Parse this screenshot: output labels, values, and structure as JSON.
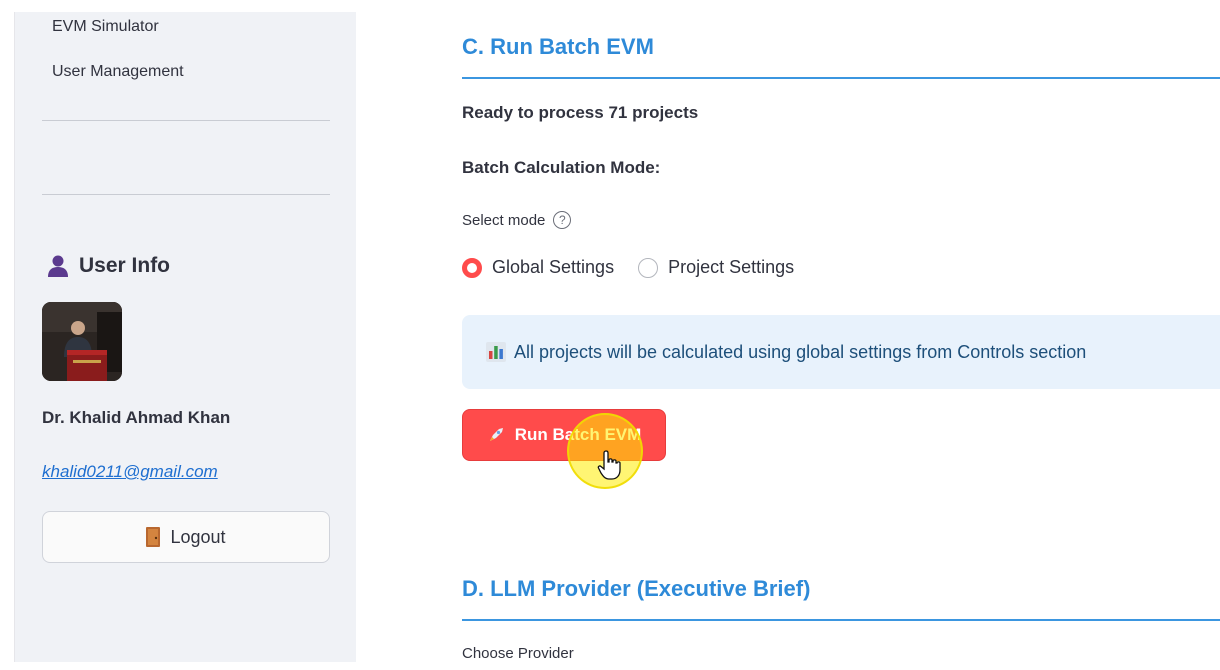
{
  "sidebar": {
    "nav_items": [
      {
        "label": "EVM Simulator"
      },
      {
        "label": "User Management"
      }
    ],
    "user_info": {
      "heading": "User Info",
      "name": "Dr. Khalid Ahmad Khan",
      "email": "khalid0211@gmail.com",
      "logout_label": "Logout"
    }
  },
  "main": {
    "section_c": {
      "title": "C. Run Batch EVM",
      "ready_text": "Ready to process 71 projects",
      "mode_heading": "Batch Calculation Mode:",
      "select_label": "Select mode",
      "help_glyph": "?",
      "options": [
        {
          "label": "Global Settings",
          "selected": true
        },
        {
          "label": "Project Settings",
          "selected": false
        }
      ],
      "info_text": "All projects will be calculated using global settings from Controls section",
      "run_button_label": "Run Batch EVM"
    },
    "section_d": {
      "title": "D. LLM Provider (Executive Brief)",
      "choose_label": "Choose Provider"
    }
  },
  "colors": {
    "accent_red": "#ff4b4b",
    "heading_blue": "#2e8ad8",
    "sidebar_bg": "#f0f2f6",
    "info_bg": "#e8f2fc",
    "link_blue": "#1f6fd0"
  },
  "icons": {
    "user": "user-silhouette-icon",
    "logout": "door-icon",
    "info": "bar-chart-icon",
    "run": "rocket-icon",
    "help": "question-circle-icon"
  }
}
